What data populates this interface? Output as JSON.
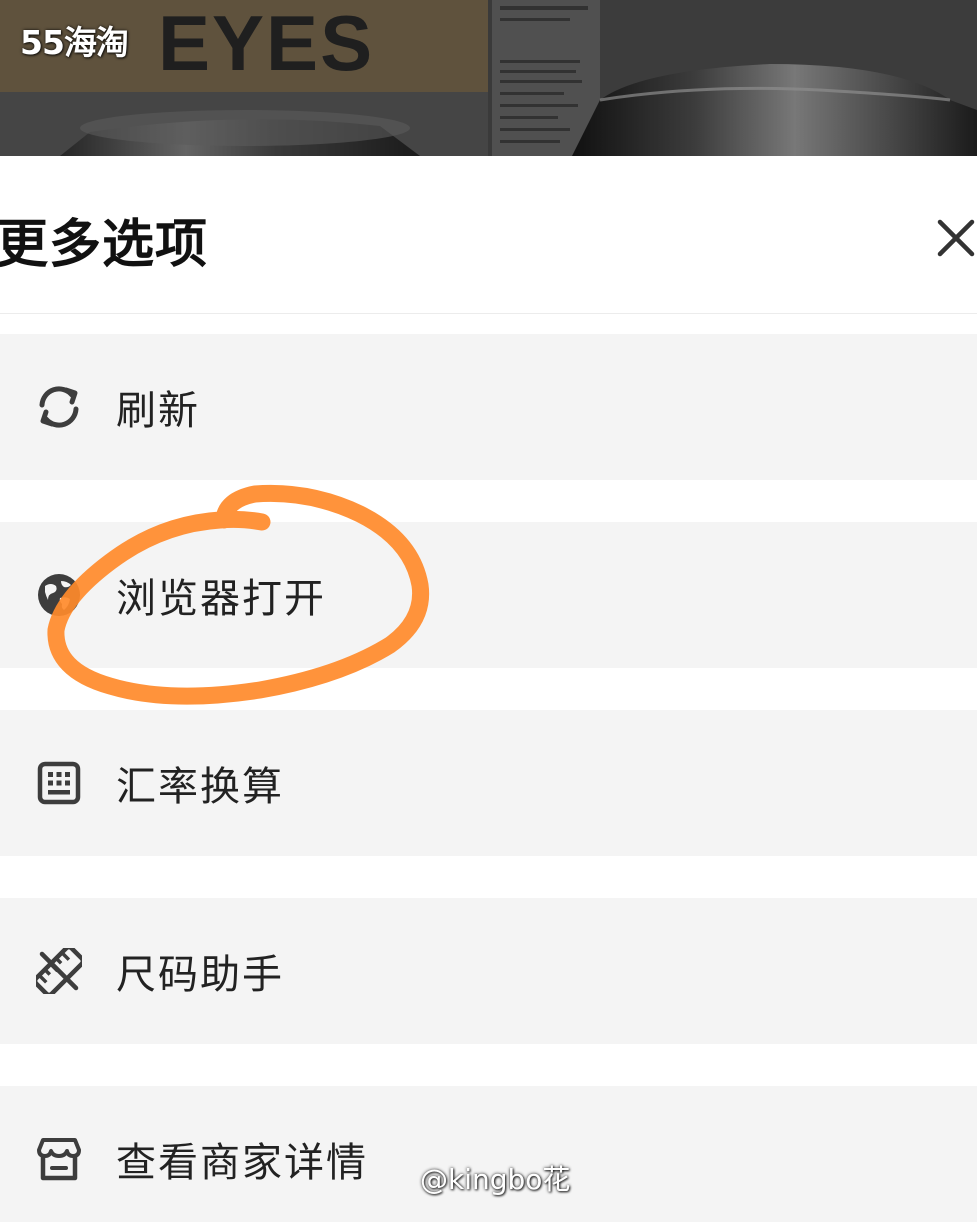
{
  "hero": {
    "watermark_text": "55海淘",
    "brand_text": "EYES"
  },
  "sheet": {
    "title": "更多选项",
    "close_icon": "close-icon"
  },
  "menu": {
    "items": [
      {
        "label": "刷新",
        "icon": "refresh-icon"
      },
      {
        "label": "浏览器打开",
        "icon": "browser-globe-icon"
      },
      {
        "label": "汇率换算",
        "icon": "calculator-icon"
      },
      {
        "label": "尺码助手",
        "icon": "ruler-icon"
      },
      {
        "label": "查看商家详情",
        "icon": "store-icon"
      }
    ]
  },
  "annotation": {
    "color": "#ff8a2a"
  },
  "watermark": {
    "user": "@kingbo花"
  },
  "colors": {
    "item_background": "#f4f4f4",
    "text": "#222222",
    "title": "#111111"
  }
}
